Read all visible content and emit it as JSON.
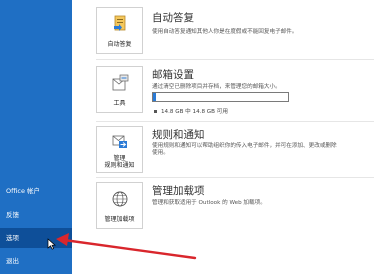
{
  "nav": {
    "items": [
      {
        "label": "Office 帐户"
      },
      {
        "label": "反馈"
      },
      {
        "label": "选项"
      },
      {
        "label": "退出"
      }
    ]
  },
  "sections": [
    {
      "title": "自动答复",
      "desc": "使用自动答复通知其他人你是在度假或不能回复电子邮件。",
      "tile_label": "自动答复",
      "icon": "auto-reply-icon"
    },
    {
      "title": "邮箱设置",
      "desc": "通过清空已删除项目并存档，来管理您的邮箱大小。",
      "tile_label": "工具",
      "icon": "mailbox-tools-icon",
      "storage_text": "14.8 GB 中 14.8 GB 可用",
      "storage_used_fraction": 0.02
    },
    {
      "title": "规则和通知",
      "desc_lines": [
        "使用规则和通知可以帮助组织你的传入电子邮件，并可在添加、更改或删除",
        "使用。"
      ],
      "tile_label_lines": [
        "管理",
        "规则和通知"
      ],
      "icon": "rules-alerts-icon"
    },
    {
      "title": "管理加载项",
      "desc": "管理和获取适用于 Outlook 的 Web 加载项。",
      "tile_label": "管理加载项",
      "icon": "add-ins-globe-icon"
    }
  ],
  "colors": {
    "nav_bg": "#1f6fc4",
    "nav_selected": "#0e4f99",
    "progress": "#2b7bd6",
    "annotation_arrow": "#d9262c"
  }
}
